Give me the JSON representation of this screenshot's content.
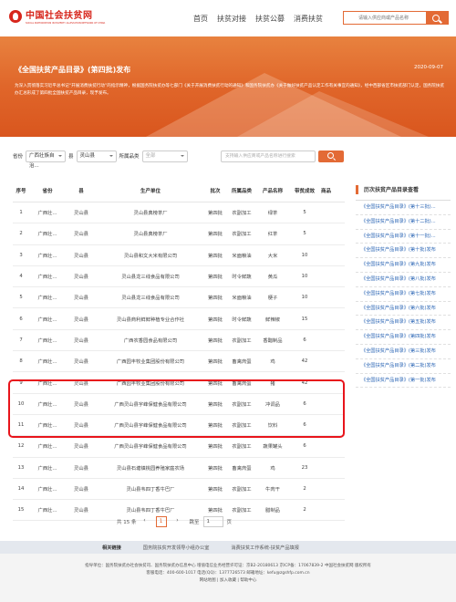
{
  "header": {
    "logo_title": "中国社会扶贫网",
    "logo_sub": "SOCIAL PARTICIPATION IN POVERTY ALLEVIATION NETWORK OF CHINA",
    "nav": [
      "首页",
      "扶贫对接",
      "扶贫公募",
      "消费扶贫"
    ],
    "search_placeholder": "请输入供应商或产品名称"
  },
  "banner": {
    "title": "《全国扶贫产品目录》(第四批)发布",
    "date": "2020-09-07",
    "desc": "为深入贯彻落实习近平总书记“开展消费扶贫行动”的指示精神，根据国务院扶贫办等七部门《关于开展消费扶贫行动的通知》和国务院扶贫办《关于做好扶贫产品认定工作有关事宜的通知》，经中西部省区市扶贫部门认定，国务院扶贫办汇总形成了第四批全国扶贫产品目录，现予发布。"
  },
  "filter": {
    "province_label": "省份",
    "province_value": "广西壮族自治...",
    "county_label": "县",
    "county_value": "灵山县",
    "category_label": "所属品类",
    "category_value": "全部",
    "keyword_placeholder": "支持输入供应商或产品名称进行搜索"
  },
  "table": {
    "headers": [
      "序号",
      "省份",
      "县",
      "生产单位",
      "批次",
      "所属品类",
      "产品名称",
      "带贫成效",
      "商品"
    ],
    "rows": [
      [
        "1",
        "广西壮...",
        "灵山县",
        "灵山县典榜茶厂",
        "第四批",
        "农副加工",
        "绿茶",
        "5",
        ""
      ],
      [
        "2",
        "广西壮...",
        "灵山县",
        "灵山县典榜茶厂",
        "第四批",
        "农副加工",
        "红茶",
        "5",
        ""
      ],
      [
        "3",
        "广西壮...",
        "灵山县",
        "灵山县和文大米有限公司",
        "第四批",
        "米面粮油",
        "大米",
        "10",
        ""
      ],
      [
        "4",
        "广西壮...",
        "灵山县",
        "灵山县龙三线食品有限公司",
        "第四批",
        "时令鲜蔬",
        "黄瓜",
        "10",
        ""
      ],
      [
        "5",
        "广西壮...",
        "灵山县",
        "灵山县龙三线食品有限公司",
        "第四批",
        "米面粮油",
        "梗子",
        "10",
        ""
      ],
      [
        "6",
        "广西壮...",
        "灵山县",
        "灵山县商利鲜鲜种植专业合作社",
        "第四批",
        "时令鲜蔬",
        "鲜辣椒",
        "15",
        ""
      ],
      [
        "7",
        "广西壮...",
        "灵山县",
        "广西农香园食品有限公司",
        "第四批",
        "农副加工",
        "香醋制品",
        "6",
        ""
      ],
      [
        "8",
        "广西壮...",
        "灵山县",
        "广西园丰牧业集团股份有限公司",
        "第四批",
        "畜禽肉蛋",
        "鸡",
        "42",
        ""
      ],
      [
        "9",
        "广西壮...",
        "灵山县",
        "广西园丰牧业集团股份有限公司",
        "第四批",
        "畜禽肉蛋",
        "猪",
        "42",
        ""
      ],
      [
        "10",
        "广西壮...",
        "灵山县",
        "广西灵山县宇峰保健食品有限公司",
        "第四批",
        "农副加工",
        "冲调品",
        "6",
        ""
      ],
      [
        "11",
        "广西壮...",
        "灵山县",
        "广西灵山县宇峰保健食品有限公司",
        "第四批",
        "农副加工",
        "饮料",
        "6",
        ""
      ],
      [
        "12",
        "广西壮...",
        "灵山县",
        "广西灵山县宇峰保健食品有限公司",
        "第四批",
        "农副加工",
        "蔬果罐头",
        "6",
        ""
      ],
      [
        "13",
        "广西壮...",
        "灵山县",
        "灵山县石塘镇桃园养殖家庭农场",
        "第四批",
        "畜禽肉蛋",
        "鸡",
        "23",
        ""
      ],
      [
        "14",
        "广西壮...",
        "灵山县",
        "灵山县韦四丁香牛巴厂",
        "第四批",
        "农副加工",
        "牛肉干",
        "2",
        ""
      ],
      [
        "15",
        "广西壮...",
        "灵山县",
        "灵山县韦四丁香牛巴厂",
        "第四批",
        "农副加工",
        "腊制品",
        "2",
        ""
      ]
    ]
  },
  "pager": {
    "total": "共 15 条",
    "prev": "‹",
    "current": "1",
    "next": "›",
    "goto_label": "跳至",
    "goto_value": "1",
    "page_suffix": "页"
  },
  "sidebar": {
    "title": "历次扶贫产品目录查看",
    "items": [
      "《全国扶贫产品目录》(第十三批)...",
      "《全国扶贫产品目录》(第十二批)...",
      "《全国扶贫产品目录》(第十一批)...",
      "《全国扶贫产品目录》(第十批)发布",
      "《全国扶贫产品目录》(第九批)发布",
      "《全国扶贫产品目录》(第八批)发布",
      "《全国扶贫产品目录》(第七批)发布",
      "《全国扶贫产品目录》(第六批)发布",
      "《全国扶贫产品目录》(第五批)发布",
      "《全国扶贫产品目录》(第四批)发布",
      "《全国扶贫产品目录》(第三批)发布",
      "《全国扶贫产品目录》(第二批)发布",
      "《全国扶贫产品目录》(第一批)发布"
    ]
  },
  "footer": {
    "links_label": "相关链接",
    "links": [
      "国务院扶贫开发领导小组办公室",
      "消费扶贫工作系统-扶贫产品填报"
    ],
    "line1": "指导单位：国务院扶贫办社会扶贫司、国务院扶贫办信息中心 增值电信业务经营许可证：京B2-20180613 京ICP备：17067839-2 中国社会扶贫网 版权所有",
    "line2": "客服电话：400-600-1017 电话(QQ)：1377726573 邮箱地址：kefu@zgshfp.com.cn",
    "line3": "网站地图 | 加入收藏 | 帮助中心"
  }
}
